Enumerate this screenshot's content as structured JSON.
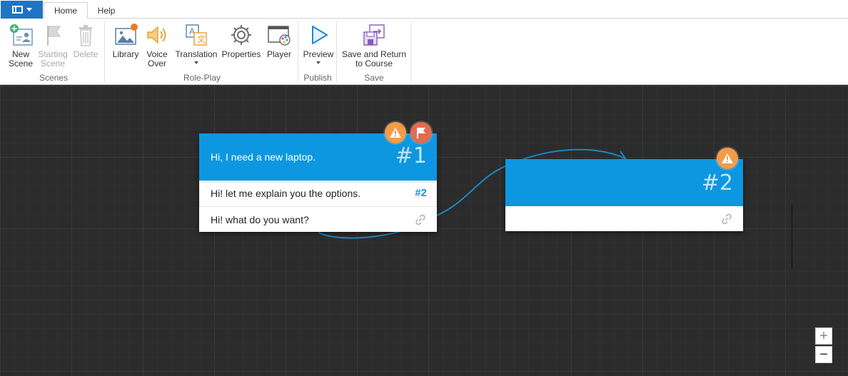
{
  "ribbon": {
    "tabs": [
      {
        "label": "Home",
        "active": true
      },
      {
        "label": "Help",
        "active": false
      }
    ],
    "buttons": {
      "new_scene": "New\nScene",
      "starting_scene": "Starting\nScene",
      "delete": "Delete",
      "library": "Library",
      "voice_over": "Voice\nOver",
      "translation": "Translation",
      "properties": "Properties",
      "player": "Player",
      "preview": "Preview",
      "save_return": "Save and Return\nto Course"
    },
    "groups": {
      "scenes": "Scenes",
      "role_play": "Role-Play",
      "publish": "Publish",
      "save": "Save"
    }
  },
  "scenes": [
    {
      "text": "Hi, I need a new laptop.",
      "number": "#1",
      "replies": [
        {
          "text": "Hi! let me explain you the options.",
          "target": "#2"
        },
        {
          "text": "Hi! what do you want?",
          "target": ""
        }
      ]
    },
    {
      "text": "",
      "number": "#2",
      "replies": [
        {
          "text": "",
          "target": ""
        }
      ]
    }
  ],
  "zoom": {
    "in": "+",
    "out": "−"
  },
  "colors": {
    "accent": "#0d97e0",
    "warning": "#f29c47",
    "flag": "#e36b4e",
    "canvas": "#2c2c2c",
    "connector": "#1e86c0",
    "app_menu": "#1f74c4"
  },
  "icons": [
    "app-menu-icon",
    "new-scene-icon",
    "starting-scene-flag-icon",
    "trash-icon",
    "library-icon",
    "speaker-icon",
    "translation-icon",
    "gear-icon",
    "player-icon",
    "play-icon",
    "save-return-icon",
    "warning-icon",
    "flag-icon",
    "link-icon"
  ]
}
